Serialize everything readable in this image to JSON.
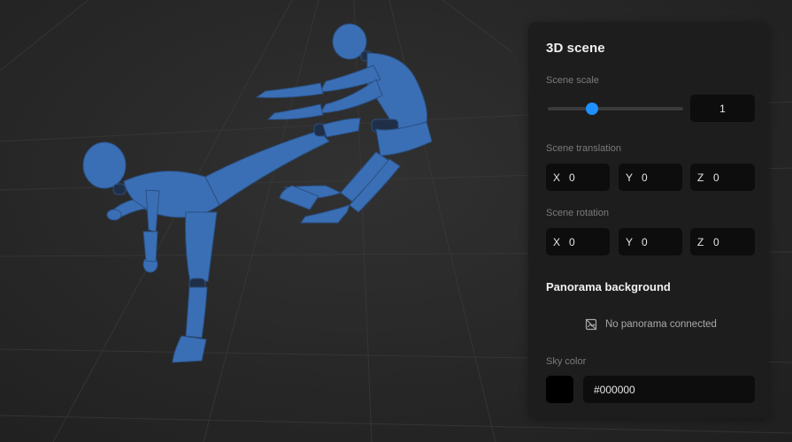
{
  "panel": {
    "title": "3D scene",
    "scene_scale": {
      "label": "Scene scale",
      "value": "1",
      "slider_fraction": 0.33
    },
    "scene_translation": {
      "label": "Scene translation",
      "x_label": "X",
      "x": "0",
      "y_label": "Y",
      "y": "0",
      "z_label": "Z",
      "z": "0"
    },
    "scene_rotation": {
      "label": "Scene rotation",
      "x_label": "X",
      "x": "0",
      "y_label": "Y",
      "y": "0",
      "z_label": "Z",
      "z": "0"
    },
    "panorama": {
      "title": "Panorama background",
      "status": "No panorama connected",
      "icon": "no-image-icon"
    },
    "sky_color": {
      "label": "Sky color",
      "value": "#000000",
      "swatch": "#000000"
    }
  },
  "colors": {
    "accent": "#1e90ff",
    "figure": "#3a6fb5",
    "panel_bg": "#1d1d1d",
    "field_bg": "#0d0d0d"
  }
}
